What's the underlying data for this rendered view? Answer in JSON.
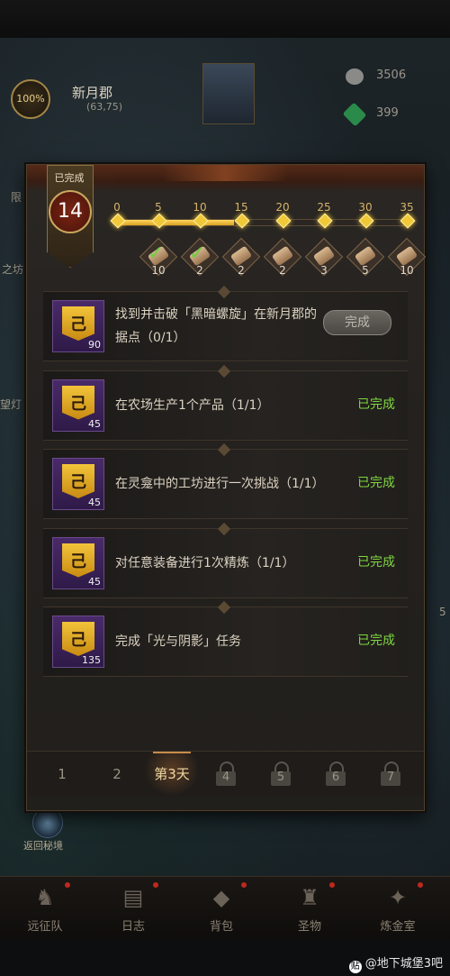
{
  "hud": {
    "progress_text": "100%",
    "location_name": "新月郡",
    "coords": "(63,75)",
    "resource_silver": "3506",
    "resource_gem": "399",
    "side_labels": [
      "限",
      "之坊",
      "望灯",
      "5"
    ],
    "return_label": "返回秘境"
  },
  "panel": {
    "badge_caption": "已完成",
    "completed_count": "14",
    "milestones": [
      {
        "label": "0"
      },
      {
        "label": "5"
      },
      {
        "label": "10"
      },
      {
        "label": "15"
      },
      {
        "label": "20"
      },
      {
        "label": "25"
      },
      {
        "label": "30"
      },
      {
        "label": "35"
      }
    ],
    "progress_value": 14,
    "progress_max": 35,
    "rewards": [
      {
        "count": "10",
        "claimed": true
      },
      {
        "count": "2",
        "claimed": true
      },
      {
        "count": "2",
        "claimed": false
      },
      {
        "count": "2",
        "claimed": false
      },
      {
        "count": "3",
        "claimed": false
      },
      {
        "count": "5",
        "claimed": false
      },
      {
        "count": "10",
        "claimed": false
      }
    ],
    "tasks": [
      {
        "text": "找到并击破「黑暗螺旋」在新月郡的据点（0/1）",
        "qty": "90",
        "status": "完成",
        "done": false
      },
      {
        "text": "在农场生产1个产品（1/1）",
        "qty": "45",
        "status": "已完成",
        "done": true
      },
      {
        "text": "在灵龛中的工坊进行一次挑战（1/1）",
        "qty": "45",
        "status": "已完成",
        "done": true
      },
      {
        "text": "对任意装备进行1次精炼（1/1）",
        "qty": "45",
        "status": "已完成",
        "done": true
      },
      {
        "text": "完成「光与阴影」任务",
        "qty": "135",
        "status": "已完成",
        "done": true
      }
    ],
    "tabs": [
      {
        "label": "1",
        "locked": false,
        "active": false
      },
      {
        "label": "2",
        "locked": false,
        "active": false
      },
      {
        "label": "第3天",
        "locked": false,
        "active": true
      },
      {
        "label": "4",
        "locked": true,
        "active": false
      },
      {
        "label": "5",
        "locked": true,
        "active": false
      },
      {
        "label": "6",
        "locked": true,
        "active": false
      },
      {
        "label": "7",
        "locked": true,
        "active": false
      }
    ]
  },
  "bottom_nav": [
    {
      "label": "远征队",
      "icon": "helmet-icon"
    },
    {
      "label": "日志",
      "icon": "journal-icon"
    },
    {
      "label": "背包",
      "icon": "bag-icon"
    },
    {
      "label": "圣物",
      "icon": "relic-icon"
    },
    {
      "label": "炼金室",
      "icon": "alchemy-icon"
    }
  ],
  "watermark": "@地下城堡3吧",
  "colors": {
    "accent": "#f0c838",
    "done_green": "#7ed640",
    "panel_bg": "#24211e"
  }
}
